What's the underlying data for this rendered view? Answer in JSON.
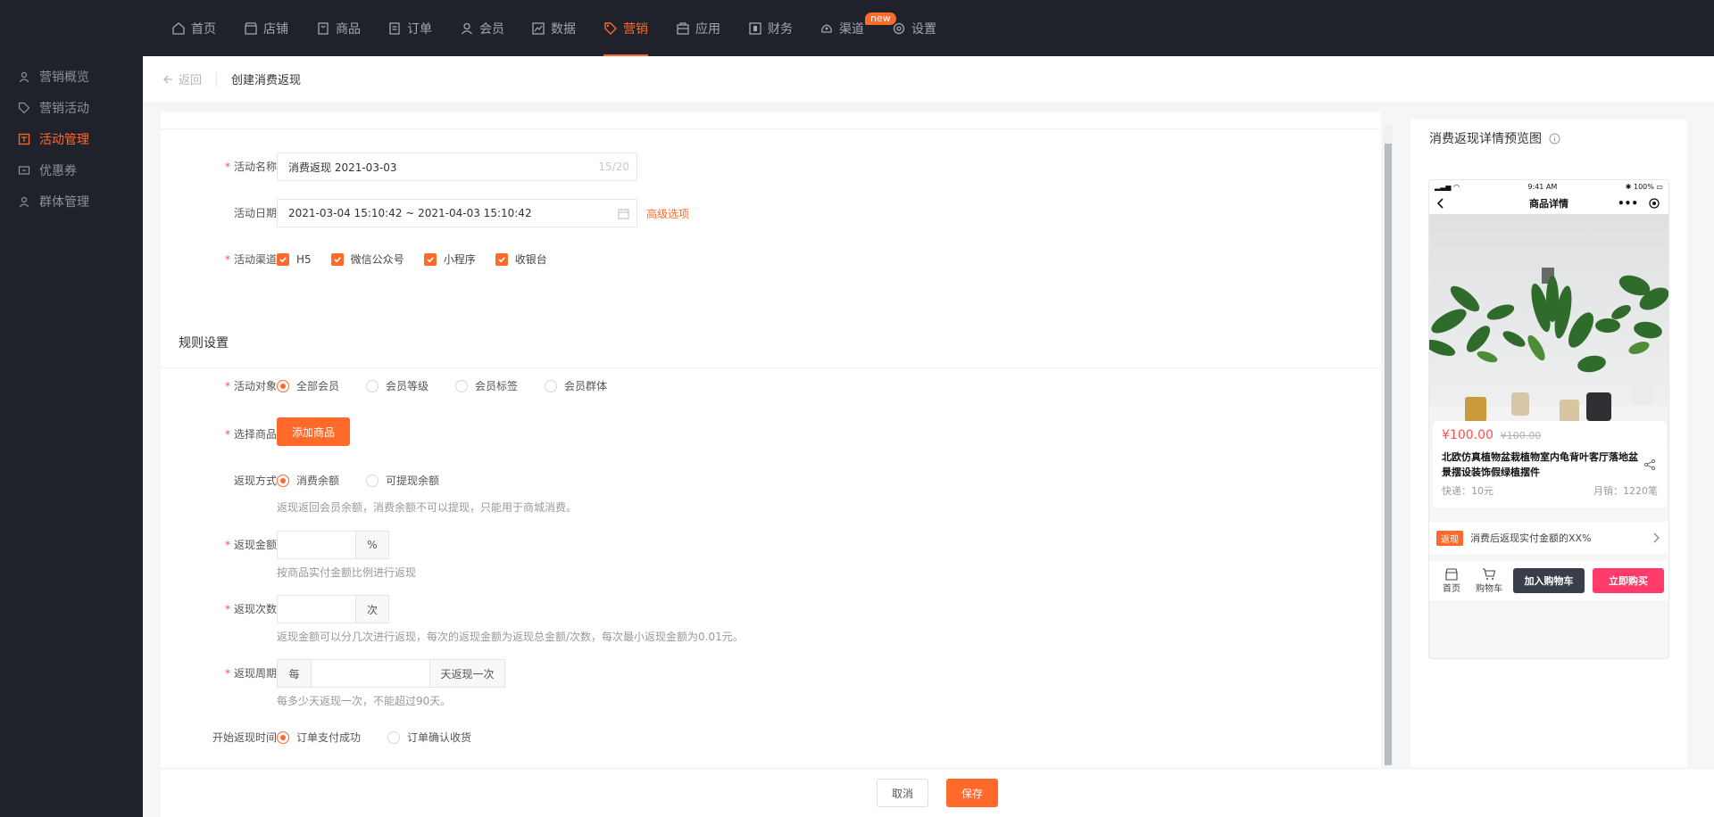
{
  "nav": {
    "items": [
      {
        "label": "首页",
        "icon": "home-icon"
      },
      {
        "label": "店铺",
        "icon": "store-icon"
      },
      {
        "label": "商品",
        "icon": "goods-icon"
      },
      {
        "label": "订单",
        "icon": "order-icon"
      },
      {
        "label": "会员",
        "icon": "user-icon"
      },
      {
        "label": "数据",
        "icon": "chart-icon"
      },
      {
        "label": "营销",
        "icon": "tag-icon"
      },
      {
        "label": "应用",
        "icon": "app-icon"
      },
      {
        "label": "财务",
        "icon": "finance-icon"
      },
      {
        "label": "渠道",
        "icon": "channel-icon"
      },
      {
        "label": "设置",
        "icon": "gear-icon"
      }
    ],
    "active": "营销",
    "badge": "new"
  },
  "sidebar": {
    "items": [
      {
        "label": "营销概览"
      },
      {
        "label": "营销活动"
      },
      {
        "label": "活动管理"
      },
      {
        "label": "优惠券"
      },
      {
        "label": "群体管理"
      }
    ],
    "active": "活动管理"
  },
  "breadcrumb": {
    "back": "返回",
    "title": "创建消费返现"
  },
  "basic": {
    "name_label": "活动名称",
    "name_value": "消费返现 2021-03-03",
    "name_counter": "15/20",
    "date_label": "活动日期",
    "date_value": "2021-03-04 15:10:42 ~ 2021-04-03 15:10:42",
    "advanced": "高级选项",
    "channel_label": "活动渠道",
    "channels": [
      "H5",
      "微信公众号",
      "小程序",
      "收银台"
    ]
  },
  "rules": {
    "header": "规则设置",
    "target_label": "活动对象",
    "targets": [
      "全部会员",
      "会员等级",
      "会员标签",
      "会员群体"
    ],
    "goods_label": "选择商品",
    "add_goods": "添加商品",
    "method_label": "返现方式",
    "methods": [
      "消费余额",
      "可提现余额"
    ],
    "method_hint": "返现返回会员余额，消费余额不可以提现，只能用于商城消费。",
    "amount_label": "返现金额",
    "amount_unit": "%",
    "amount_hint": "按商品实付金额比例进行返现",
    "times_label": "返现次数",
    "times_unit": "次",
    "times_hint": "返现金额可以分几次进行返现，每次的返现金额为返现总金额/次数，每次最小返现金额为0.01元。",
    "period_label": "返现周期",
    "period_prefix": "每",
    "period_suffix": "天返现一次",
    "period_hint": "每多少天返现一次，不能超过90天。",
    "start_label": "开始返现时间",
    "starts": [
      "订单支付成功",
      "订单确认收货"
    ]
  },
  "footer": {
    "cancel": "取消",
    "save": "保存"
  },
  "preview": {
    "title": "消费返现详情预览图",
    "status_time": "9:41 AM",
    "status_battery": "100%",
    "page_title": "商品详情",
    "price": "¥100.00",
    "price_old": "¥100.00",
    "product_title": "北欧仿真植物盆栽植物室内龟背叶客厅落地盆景摆设装饰假绿植摆件",
    "shipping": "快递：10元",
    "sales": "月销：1220笔",
    "cashback_tag": "返现",
    "cashback_text": "消费后返现实付金额的XX%",
    "home": "首页",
    "cart": "购物车",
    "add_cart": "加入购物车",
    "buy_now": "立即购买"
  },
  "colors": {
    "accent": "#ff6a2b",
    "dark": "#1f222b",
    "buy": "#ff3b6b",
    "cart_btn": "#3a3d4a"
  }
}
